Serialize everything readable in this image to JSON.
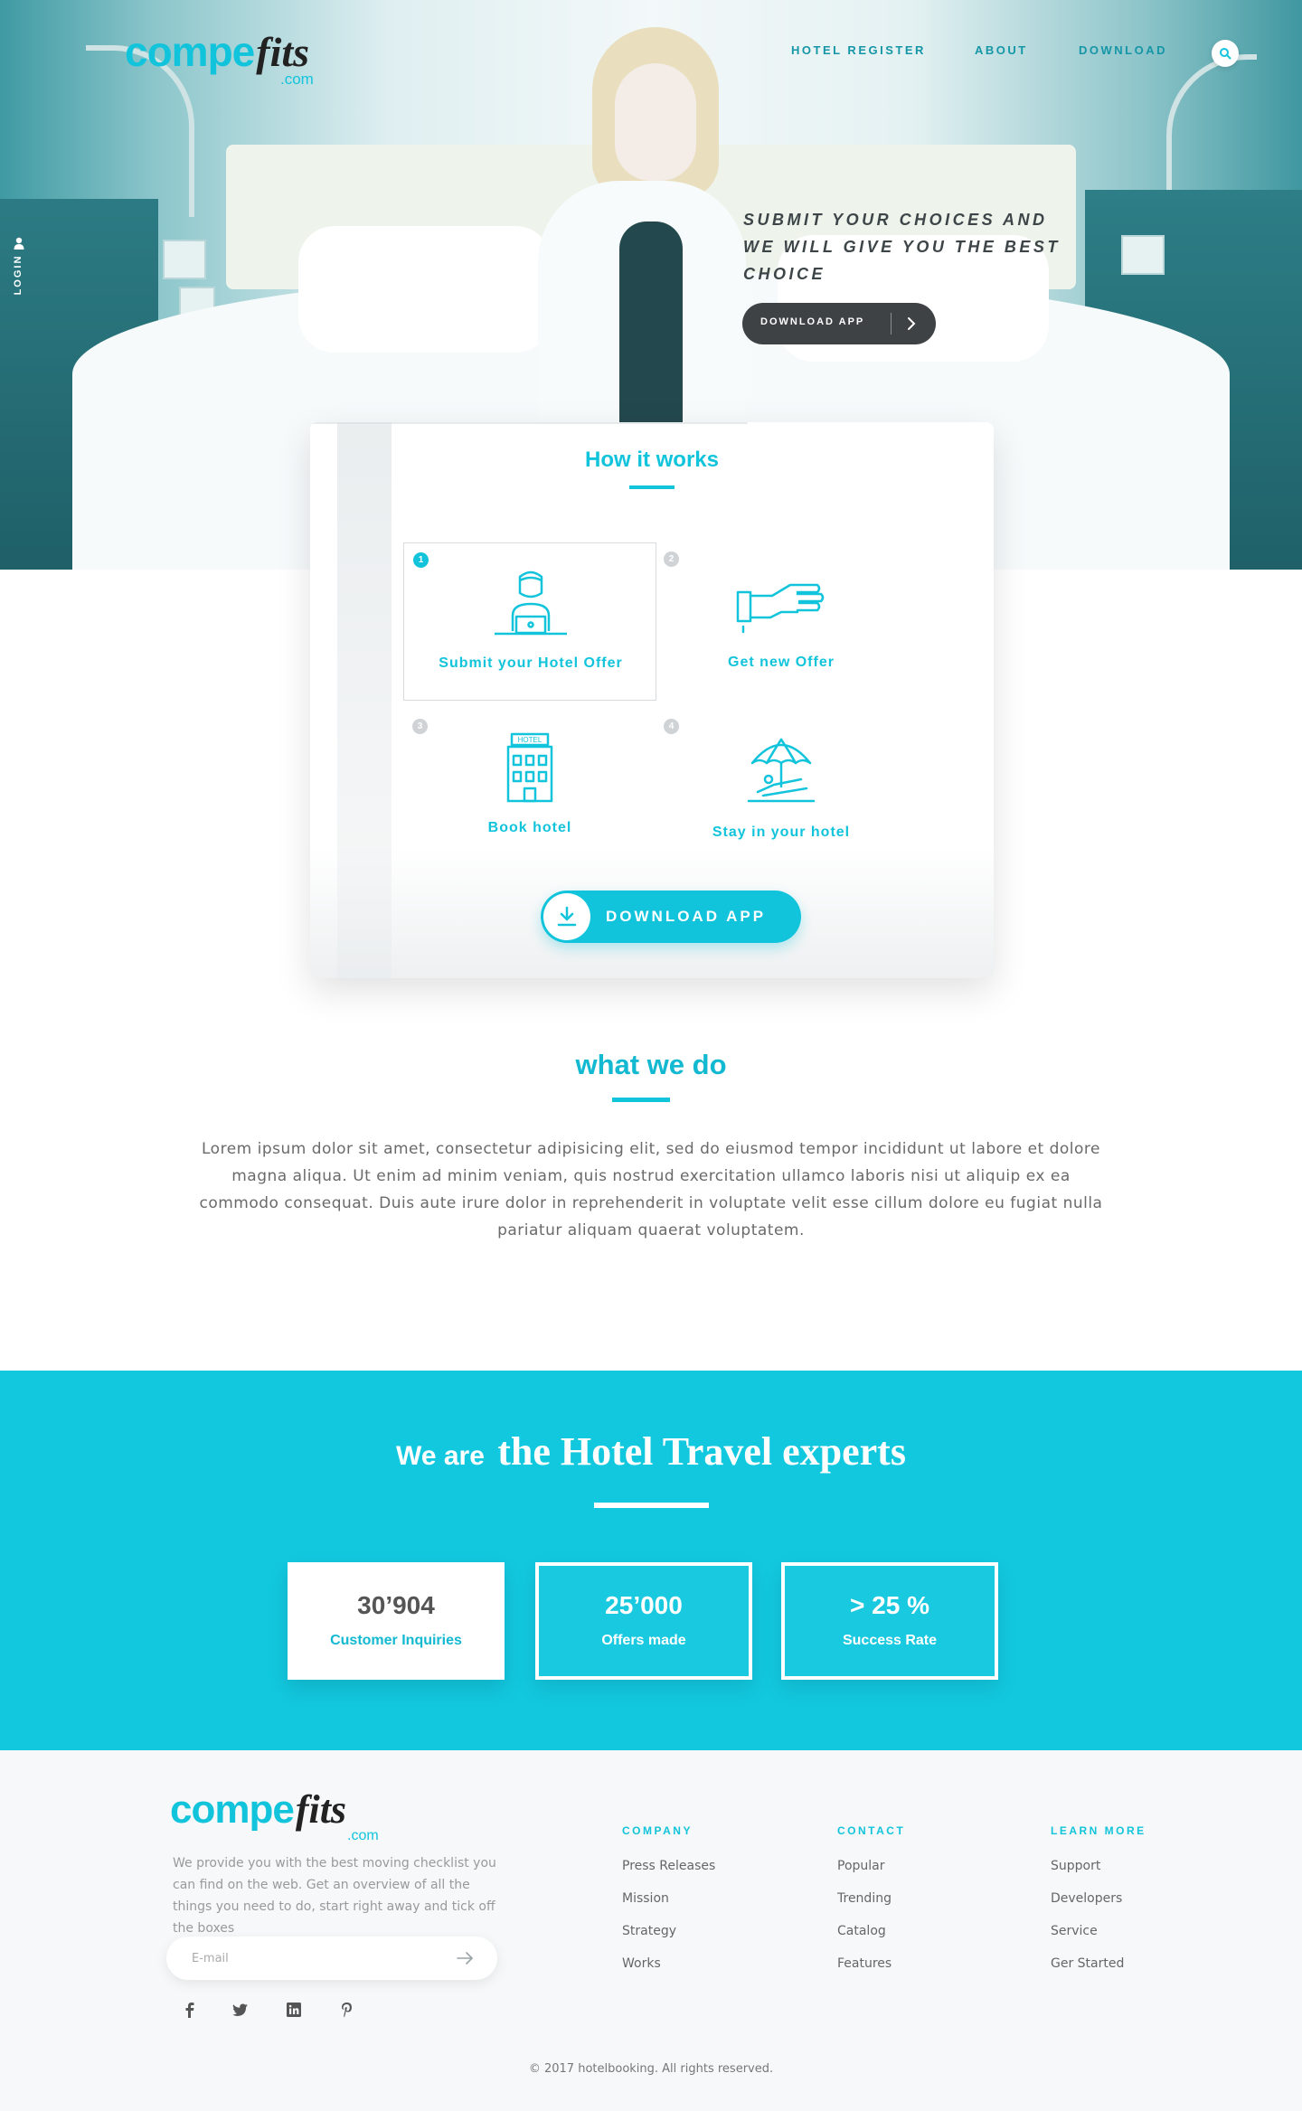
{
  "brand": {
    "name_a": "compe",
    "name_b": "fits",
    "suffix": ".com",
    "color": "#12c4db"
  },
  "nav": {
    "items": [
      "HOTEL REGISTER",
      "ABOUT",
      "DOWNLOAD"
    ],
    "search_icon": "search-icon"
  },
  "sidebar": {
    "login_label": "LOGIN",
    "icon": "user-icon"
  },
  "hero": {
    "tagline": "SUBMIT YOUR CHOICES AND WE WILL GIVE YOU THE BEST CHOICE",
    "button_label": "DOWNLOAD APP",
    "button_icon": "chevron-right-icon"
  },
  "how_it_works": {
    "title": "How it works",
    "steps": [
      {
        "num": "1",
        "label": "Submit your Hotel Offer",
        "icon": "person-laptop-icon"
      },
      {
        "num": "2",
        "label": "Get new Offer",
        "icon": "handshake-icon"
      },
      {
        "num": "3",
        "label": "Book hotel",
        "icon": "hotel-building-icon",
        "sign": "HOTEL"
      },
      {
        "num": "4",
        "label": "Stay in your hotel",
        "icon": "beach-umbrella-icon"
      }
    ],
    "button_label": "DOWNLOAD APP",
    "button_icon": "download-icon"
  },
  "what_we_do": {
    "title": "what we do",
    "text": "Lorem ipsum dolor sit amet, consectetur adipisicing elit, sed do eiusmod tempor incididunt ut labore et dolore magna aliqua. Ut enim ad minim veniam, quis nostrud exercitation ullamco laboris nisi ut aliquip ex ea commodo consequat. Duis aute irure dolor in reprehenderit in voluptate velit esse cillum dolore eu fugiat nulla pariatur aliquam quaerat voluptatem."
  },
  "experts": {
    "title_pre": "We are",
    "title_main": "the Hotel Travel experts",
    "band_color": "#12c8df",
    "stats": [
      {
        "value": "30’904",
        "label": "Customer Inquiries"
      },
      {
        "value": "25’000",
        "label": "Offers made"
      },
      {
        "value": "> 25 %",
        "label": "Success Rate"
      }
    ]
  },
  "footer": {
    "description": "We provide you with the best moving checklist you can find on the web. Get an overview of all the things you need to do, start right away and tick off the boxes",
    "email_placeholder": "E-mail",
    "email_submit_icon": "arrow-right-icon",
    "social": [
      "facebook-icon",
      "twitter-icon",
      "linkedin-icon",
      "pinterest-icon"
    ],
    "columns": [
      {
        "heading": "COMPANY",
        "items": [
          "Press Releases",
          "Mission",
          "Strategy",
          "Works"
        ]
      },
      {
        "heading": "CONTACT",
        "items": [
          "Popular",
          "Trending",
          "Catalog",
          "Features"
        ]
      },
      {
        "heading": "LEARN MORE",
        "items": [
          "Support",
          "Developers",
          "Service",
          "Ger Started"
        ]
      }
    ],
    "copyright": "© 2017 hotelbooking. All rights reserved."
  }
}
